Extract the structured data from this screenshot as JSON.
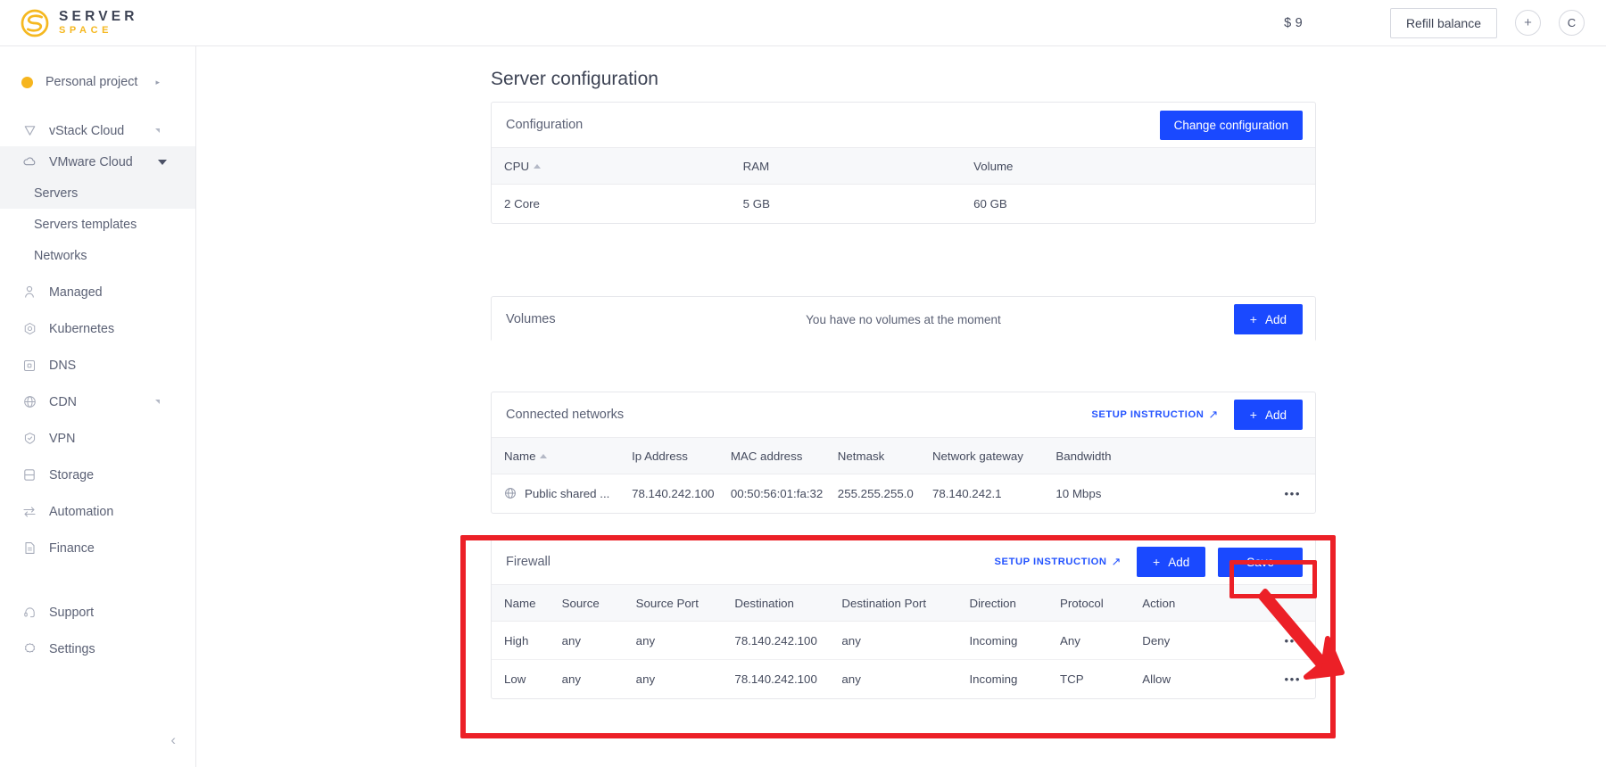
{
  "topbar": {
    "logo_line1": "SERVER",
    "logo_line2": "SPACE",
    "balance": "$ 9",
    "refill_label": "Refill balance",
    "add_icon": "+",
    "avatar_label": "C"
  },
  "sidebar": {
    "project": {
      "label": "Personal project",
      "icon": "project-dot",
      "chevron": "▸"
    },
    "items": [
      {
        "label": "vStack Cloud",
        "icon": "shield-icon",
        "expand": "collapsed"
      },
      {
        "label": "VMware Cloud",
        "icon": "cloud-icon",
        "expand": "expanded",
        "active": true
      },
      {
        "label": "Servers",
        "icon": "none",
        "sub": true,
        "active": true
      },
      {
        "label": "Servers templates",
        "icon": "none",
        "sub": true
      },
      {
        "label": "Networks",
        "icon": "none",
        "sub": true
      },
      {
        "label": "Managed",
        "icon": "person-icon"
      },
      {
        "label": "Kubernetes",
        "icon": "kubernetes-icon"
      },
      {
        "label": "DNS",
        "icon": "dns-icon"
      },
      {
        "label": "CDN",
        "icon": "globe-icon",
        "expand": "collapsed"
      },
      {
        "label": "VPN",
        "icon": "vpn-shield-icon"
      },
      {
        "label": "Storage",
        "icon": "database-icon"
      },
      {
        "label": "Automation",
        "icon": "automation-icon"
      },
      {
        "label": "Finance",
        "icon": "document-icon"
      }
    ],
    "bottom_items": [
      {
        "label": "Support",
        "icon": "headset-icon"
      },
      {
        "label": "Settings",
        "icon": "gear-icon"
      }
    ],
    "collapse_icon": "‹"
  },
  "main": {
    "page_title": "Server configuration",
    "configuration_card": {
      "title": "Configuration",
      "action_label": "Change configuration",
      "columns": [
        "CPU",
        "RAM",
        "Volume"
      ],
      "sorted_column": "CPU",
      "rows": [
        [
          "2 Core",
          "5 GB",
          "60 GB"
        ]
      ]
    },
    "volumes_card": {
      "title": "Volumes",
      "empty_text": "You have no volumes at the moment",
      "add_label": "Add",
      "add_icon": "+"
    },
    "networks_card": {
      "title": "Connected networks",
      "setup_label": "SETUP INSTRUCTION",
      "setup_icon": "↗",
      "add_label": "Add",
      "add_icon": "+",
      "columns": [
        "Name",
        "Ip Address",
        "MAC address",
        "Netmask",
        "Network gateway",
        "Bandwidth"
      ],
      "sorted_column": "Name",
      "rows": [
        {
          "name": "Public shared ...",
          "icon": "globe-icon",
          "ip": "78.140.242.100",
          "mac": "00:50:56:01:fa:32",
          "netmask": "255.255.255.0",
          "gateway": "78.140.242.1",
          "bandwidth": "10 Mbps",
          "menu": "•••"
        }
      ]
    },
    "firewall_card": {
      "title": "Firewall",
      "setup_label": "SETUP INSTRUCTION",
      "setup_icon": "↗",
      "add_label": "Add",
      "add_icon": "+",
      "save_label": "Save",
      "columns": [
        "Name",
        "Source",
        "Source Port",
        "Destination",
        "Destination Port",
        "Direction",
        "Protocol",
        "Action"
      ],
      "rows": [
        {
          "name": "High",
          "source": "any",
          "source_port": "any",
          "destination": "78.140.242.100",
          "destination_port": "any",
          "direction": "Incoming",
          "protocol": "Any",
          "action": "Deny",
          "menu": "•••"
        },
        {
          "name": "Low",
          "source": "any",
          "source_port": "any",
          "destination": "78.140.242.100",
          "destination_port": "any",
          "direction": "Incoming",
          "protocol": "TCP",
          "action": "Allow",
          "menu": "•••"
        }
      ]
    }
  },
  "annotation": {
    "highlight_color": "#ec2027",
    "target": "Save",
    "arrow": "red-arrow-pointing-to-save-button"
  },
  "colors": {
    "accent_blue": "#1a49ff",
    "link_blue": "#2353ff",
    "brand_yellow": "#f5b820",
    "text_dark": "#3d4354",
    "text_muted": "#5b6175",
    "annotation_red": "#ec2027"
  }
}
